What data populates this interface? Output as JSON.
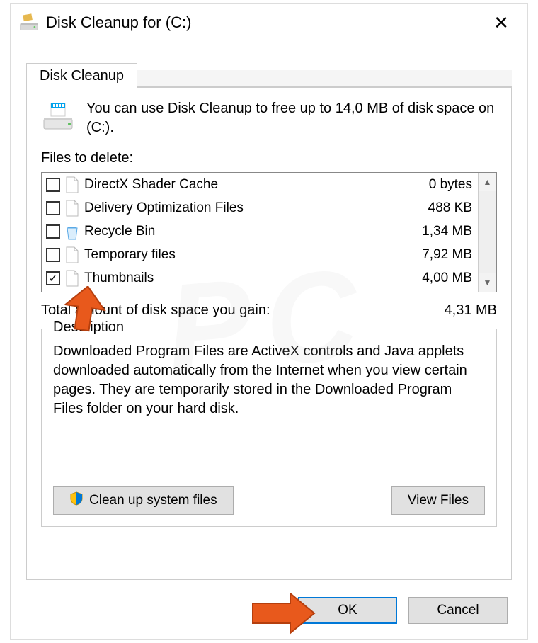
{
  "window": {
    "title": "Disk Cleanup for  (C:)"
  },
  "tab": {
    "label": "Disk Cleanup"
  },
  "intro": "You can use Disk Cleanup to free up to 14,0 MB of disk space on  (C:).",
  "files_label": "Files to delete:",
  "items": [
    {
      "checked": false,
      "icon": "file",
      "name": "DirectX Shader Cache",
      "size": "0 bytes"
    },
    {
      "checked": false,
      "icon": "file",
      "name": "Delivery Optimization Files",
      "size": "488 KB"
    },
    {
      "checked": false,
      "icon": "recycle",
      "name": "Recycle Bin",
      "size": "1,34 MB"
    },
    {
      "checked": false,
      "icon": "file",
      "name": "Temporary files",
      "size": "7,92 MB"
    },
    {
      "checked": true,
      "icon": "file",
      "name": "Thumbnails",
      "size": "4,00 MB"
    }
  ],
  "total": {
    "label": "Total amount of disk space you gain:",
    "value": "4,31 MB"
  },
  "description": {
    "legend": "Description",
    "text": "Downloaded Program Files are ActiveX controls and Java applets downloaded automatically from the Internet when you view certain pages. They are temporarily stored in the Downloaded Program Files folder on your hard disk."
  },
  "buttons": {
    "cleanup_system": "Clean up system files",
    "view_files": "View Files",
    "ok": "OK",
    "cancel": "Cancel"
  }
}
